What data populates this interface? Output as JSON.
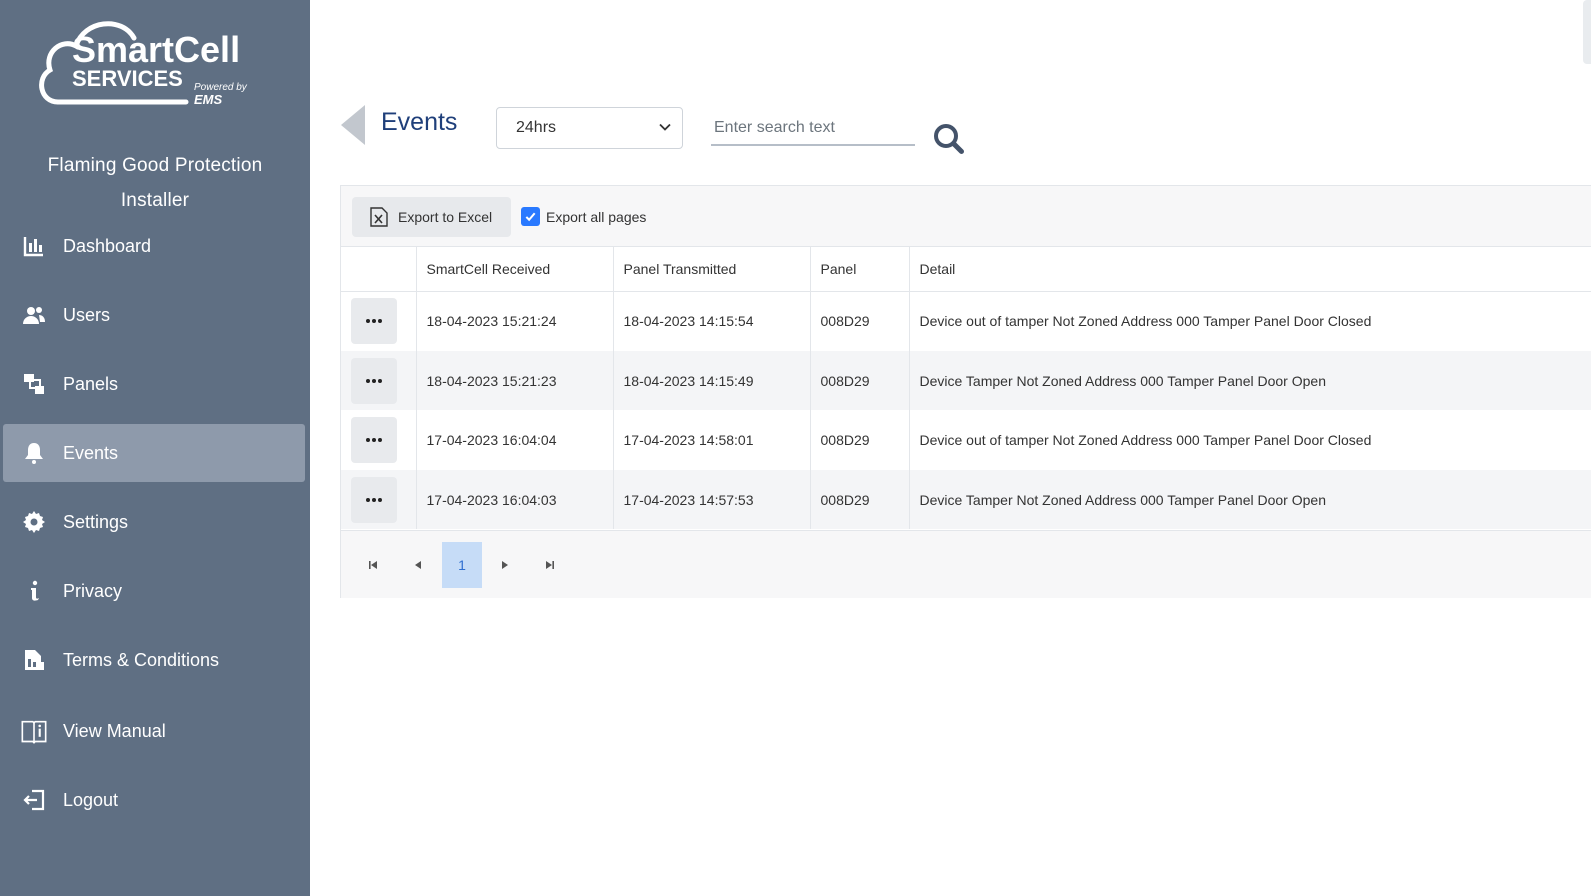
{
  "sidebar": {
    "logo_text": "SmartCell SERVICES Powered by EMS",
    "company": "Flaming Good Protection",
    "role": "Installer",
    "items": [
      {
        "label": "Dashboard",
        "icon": "bar-chart-icon"
      },
      {
        "label": "Users",
        "icon": "users-icon"
      },
      {
        "label": "Panels",
        "icon": "panels-icon"
      },
      {
        "label": "Events",
        "icon": "bell-icon",
        "active": true
      },
      {
        "label": "Settings",
        "icon": "gear-icon"
      },
      {
        "label": "Privacy",
        "icon": "info-icon"
      },
      {
        "label": "Terms & Conditions",
        "icon": "document-icon"
      },
      {
        "label": "View Manual",
        "icon": "book-icon"
      },
      {
        "label": "Logout",
        "icon": "logout-icon"
      }
    ]
  },
  "header": {
    "title": "Events",
    "range_value": "24hrs",
    "search_placeholder": "Enter search text"
  },
  "toolbar": {
    "export_label": "Export to Excel",
    "export_all_label": "Export all pages",
    "export_all_checked": true
  },
  "table": {
    "columns": [
      "",
      "SmartCell Received",
      "Panel Transmitted",
      "Panel",
      "Detail"
    ],
    "rows": [
      {
        "received": "18-04-2023 15:21:24",
        "transmitted": "18-04-2023 14:15:54",
        "panel": "008D29",
        "detail": "Device out of tamper Not Zoned Address 000 Tamper Panel Door Closed"
      },
      {
        "received": "18-04-2023 15:21:23",
        "transmitted": "18-04-2023 14:15:49",
        "panel": "008D29",
        "detail": "Device Tamper Not Zoned Address 000 Tamper Panel Door Open"
      },
      {
        "received": "17-04-2023 16:04:04",
        "transmitted": "17-04-2023 14:58:01",
        "panel": "008D29",
        "detail": "Device out of tamper Not Zoned Address 000 Tamper Panel Door Closed"
      },
      {
        "received": "17-04-2023 16:04:03",
        "transmitted": "17-04-2023 14:57:53",
        "panel": "008D29",
        "detail": "Device Tamper Not Zoned Address 000 Tamper Panel Door Open"
      }
    ]
  },
  "pager": {
    "current_page": "1"
  },
  "colors": {
    "sidebar": "#5f6f83",
    "active_item": "#8e9aab",
    "title": "#1f3f7a",
    "checkbox": "#2979ff"
  }
}
